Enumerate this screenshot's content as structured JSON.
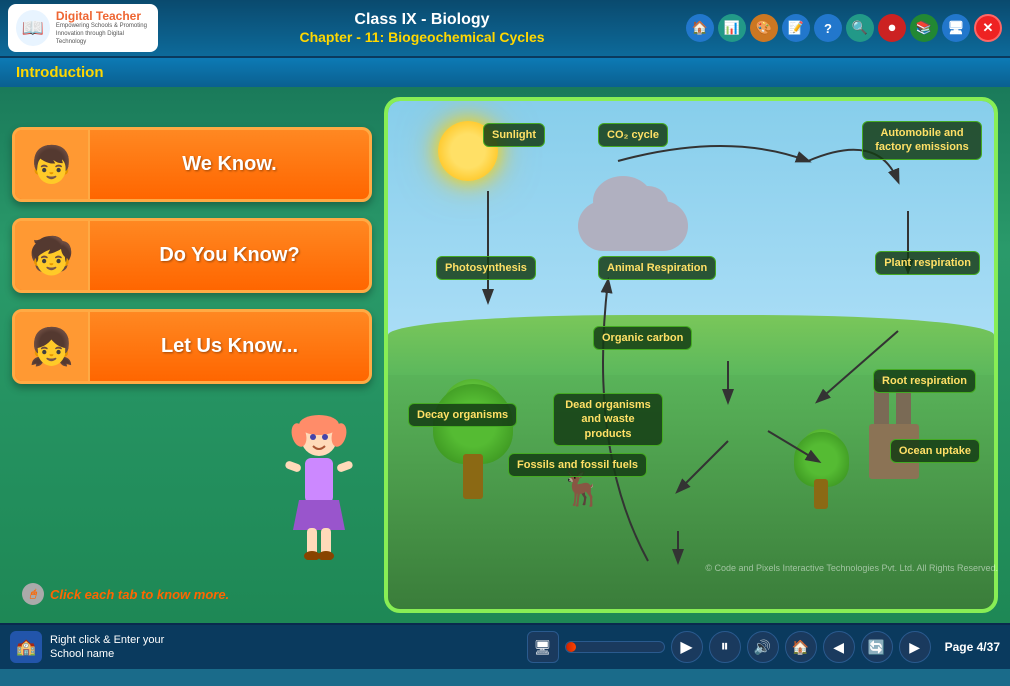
{
  "header": {
    "title": "Class IX - Biology",
    "subtitle": "Chapter - 11: Biogeochemical Cycles",
    "logo_name": "Digital Teacher",
    "logo_tagline": "Empowering Schools & Promoting\nInnovation through Digital Technology"
  },
  "section": {
    "title": "Introduction"
  },
  "nav_buttons": [
    {
      "label": "We Know.",
      "avatar": "👦"
    },
    {
      "label": "Do You Know?",
      "avatar": "🧒"
    },
    {
      "label": "Let Us Know...",
      "avatar": "👧"
    }
  ],
  "hint": {
    "text": "Click each tab to know more."
  },
  "diagram": {
    "labels": {
      "sunlight": "Sunlight",
      "co2_cycle": "CO₂ cycle",
      "auto_emissions": "Automobile and\nfactory emissions",
      "photosynthesis": "Photosynthesis",
      "animal_respiration": "Animal Respiration",
      "plant_respiration": "Plant respiration",
      "organic_carbon": "Organic carbon",
      "root_respiration": "Root respiration",
      "decay_organisms": "Decay organisms",
      "dead_organisms": "Dead organisms\nand waste products",
      "fossils": "Fossils and fossil fuels",
      "ocean_uptake": "Ocean uptake"
    }
  },
  "footer": {
    "school_label": "Right click & Enter your School\nname",
    "page_label": "Page",
    "page_current": "4",
    "page_total": "37",
    "progress_pct": 11
  },
  "copyright": "© Code and Pixels Interactive Technologies Pvt. Ltd. All Rights Reserved."
}
